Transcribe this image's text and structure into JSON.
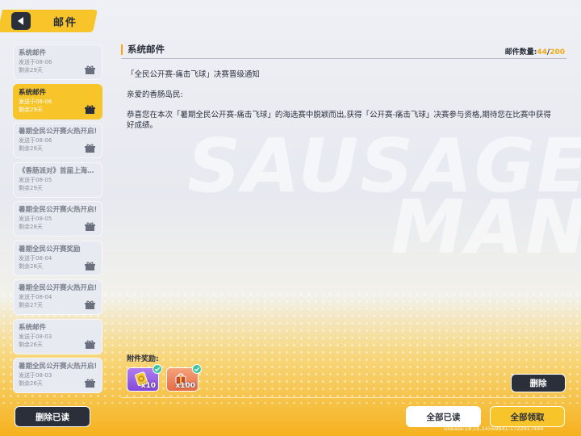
{
  "header": {
    "title": "邮件"
  },
  "background_text": [
    "SAUSAGE",
    "MAN"
  ],
  "mail_list": [
    {
      "title": "系统邮件",
      "date": "发送于08-06",
      "remaining": "剩余29天",
      "active": false
    },
    {
      "title": "系统邮件",
      "date": "发送于08-06",
      "remaining": "剩余29天",
      "active": true
    },
    {
      "title": "暑期全民公开赛火热开启!",
      "date": "发送于08-06",
      "remaining": "剩余29天",
      "active": false
    },
    {
      "title": "《香肠派对》首届上海…",
      "date": "发送于08-05",
      "remaining": "剩余29天",
      "active": false
    },
    {
      "title": "暑期全民公开赛火热开启!",
      "date": "发送于08-05",
      "remaining": "剩余28天",
      "active": false
    },
    {
      "title": "暑期全民公开赛奖励",
      "date": "发送于08-04",
      "remaining": "剩余28天",
      "active": false
    },
    {
      "title": "暑期全民公开赛火热开启!",
      "date": "发送于08-04",
      "remaining": "剩余27天",
      "active": false
    },
    {
      "title": "系统邮件",
      "date": "发送于08-03",
      "remaining": "剩余26天",
      "active": false
    },
    {
      "title": "暑期全民公开赛火热开启!",
      "date": "发送于08-03",
      "remaining": "剩余26天",
      "active": false
    }
  ],
  "panel": {
    "title": "系统邮件",
    "count_label": "邮件数量:",
    "count_current": "44",
    "count_separator": "/",
    "count_max": "200"
  },
  "message": {
    "subject": "「全民公开赛-痛击飞球」决赛晋级通知",
    "greeting": "亲爱的香肠岛民:",
    "body": "恭喜您在本次「暑期全民公开赛-痛击飞球」的海选赛中脱颖而出,获得「公开赛-痛击飞球」决赛参与资格,期待您在比赛中获得好成绩。"
  },
  "attachments": {
    "label": "附件奖励:",
    "items": [
      {
        "icon": "ticket-icon",
        "quantity": "x10",
        "claimed": true,
        "color": "#8449d8"
      },
      {
        "icon": "gift-bag-icon",
        "quantity": "x100",
        "claimed": true,
        "color": "#e76c45"
      }
    ]
  },
  "buttons": {
    "delete": "删除",
    "delete_read": "删除已读",
    "read_all": "全部已读",
    "claim_all": "全部领取"
  },
  "footer": {
    "uid": "Ullease:18.15.24569941-1722917444"
  },
  "colors": {
    "accent": "#f7c42a",
    "dark": "#2a2f3a",
    "highlight": "#f0a917"
  }
}
